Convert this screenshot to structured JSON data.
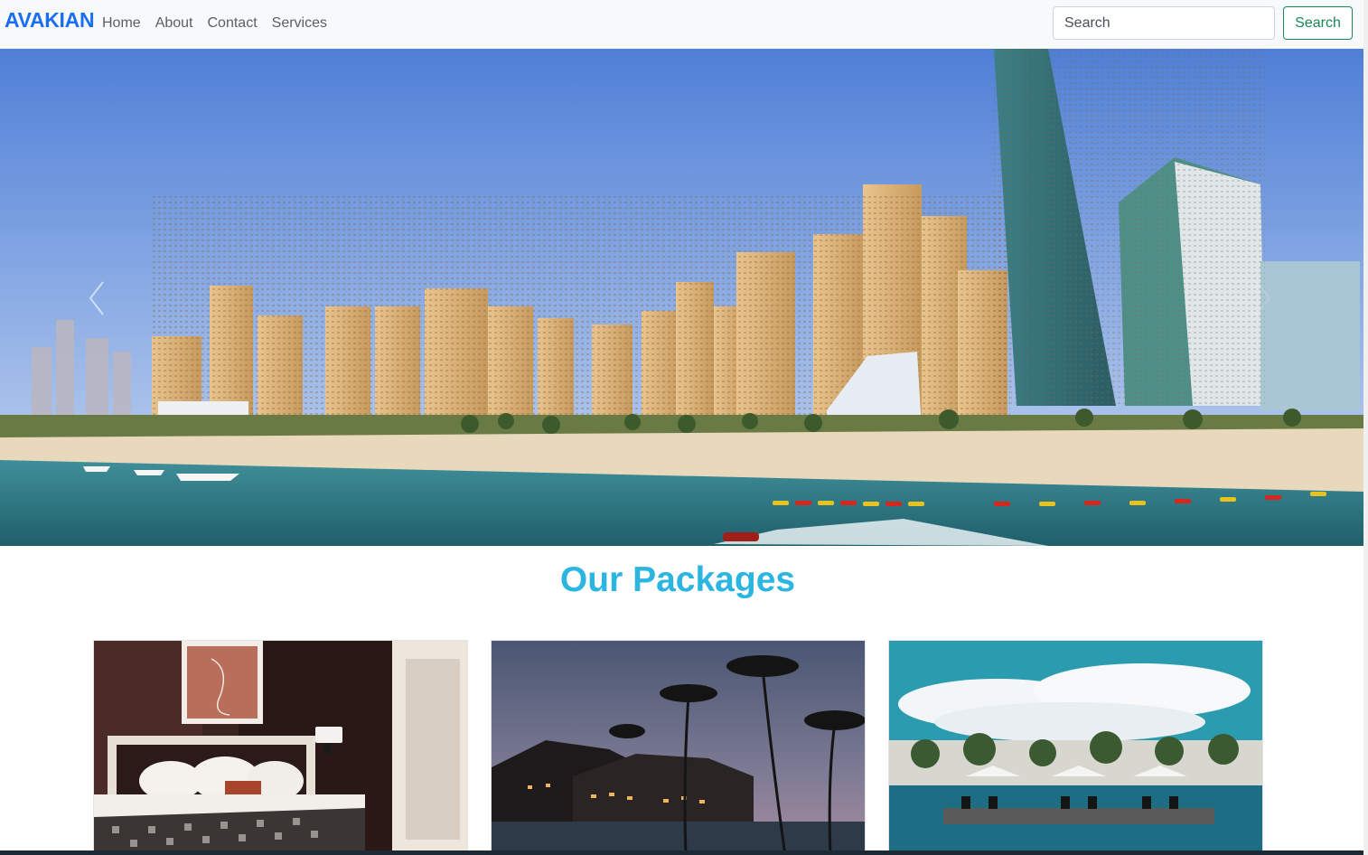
{
  "navbar": {
    "brand": "AVAKIAN",
    "links": [
      {
        "label": "Home"
      },
      {
        "label": "About"
      },
      {
        "label": "Contact"
      },
      {
        "label": "Services"
      }
    ],
    "search": {
      "placeholder": "Search",
      "value": ""
    },
    "search_button": "Search"
  },
  "hero": {
    "image": "city-beach-skyline",
    "prev_icon": "chevron-left-icon",
    "next_icon": "chevron-right-icon"
  },
  "packages": {
    "title": "Our Packages",
    "cards": [
      {
        "image": "hotel-bedroom"
      },
      {
        "image": "resort-palms-night"
      },
      {
        "image": "resort-pool-umbrellas"
      }
    ]
  },
  "colors": {
    "brand": "#1a6ff0",
    "success": "#198754",
    "title": "#2bb5e0"
  }
}
